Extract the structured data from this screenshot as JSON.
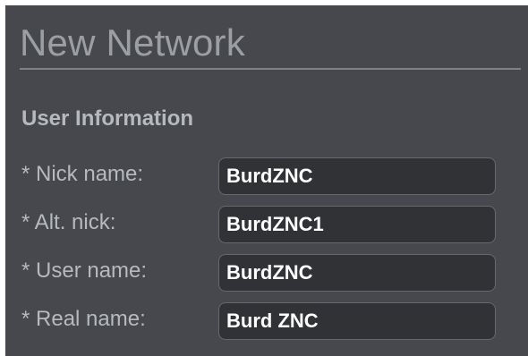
{
  "page": {
    "title": "New Network"
  },
  "user_information": {
    "heading": "User Information",
    "fields": [
      {
        "label": "* Nick name:",
        "value": "BurdZNC"
      },
      {
        "label": "* Alt. nick:",
        "value": "BurdZNC1"
      },
      {
        "label": "* User name:",
        "value": "BurdZNC"
      },
      {
        "label": "* Real name:",
        "value": "Burd ZNC"
      }
    ]
  },
  "colors": {
    "panel_background": "#46484d",
    "input_background": "#303236",
    "label_text": "#b6b9be",
    "title_text": "#9b9ea3",
    "input_text": "#ffffff"
  }
}
